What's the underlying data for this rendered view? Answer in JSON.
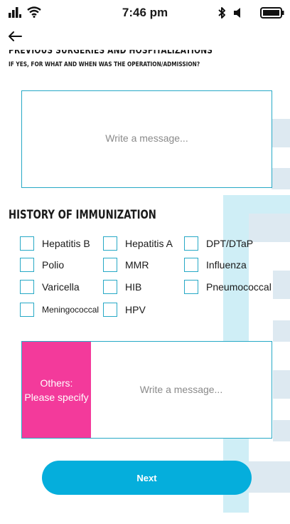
{
  "status_bar": {
    "time": "7:46 pm",
    "icons": [
      "signal-icon",
      "wifi-icon",
      "bluetooth-icon",
      "mute-icon",
      "battery-icon"
    ]
  },
  "section": {
    "title_cut": "PREVIOUS SURGERIES AND HOSPITALIZATIONS",
    "subtitle": "IF YES, FOR WHAT AND WHEN WAS THE OPERATION/ADMISSION?",
    "message_placeholder": "Write a message..."
  },
  "immunization": {
    "heading": "HISTORY OF IMMUNIZATION",
    "options": [
      {
        "label": "Hepatitis B"
      },
      {
        "label": "Hepatitis A"
      },
      {
        "label": "DPT/DTaP"
      },
      {
        "label": "Polio"
      },
      {
        "label": "MMR"
      },
      {
        "label": "Influenza"
      },
      {
        "label": "Varicella"
      },
      {
        "label": "HIB"
      },
      {
        "label": "Pneumococcal"
      },
      {
        "label": "Meningococcal"
      },
      {
        "label": "HPV"
      }
    ]
  },
  "others": {
    "label_line1": "Others:",
    "label_line2": "Please specify",
    "placeholder": "Write a message..."
  },
  "next_label": "Next",
  "colors": {
    "accent_border": "#27a9c6",
    "pink": "#f33a9b",
    "button": "#05aedc"
  }
}
